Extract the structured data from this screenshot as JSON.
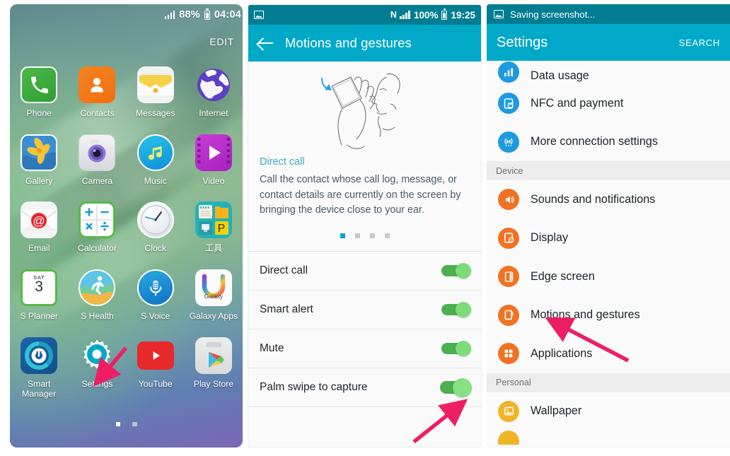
{
  "home": {
    "status": {
      "battery": "88%",
      "time": "04:04",
      "signal_icon": "signal-bars-icon",
      "battery_icon": "battery-icon"
    },
    "edit_label": "EDIT",
    "rows": [
      [
        {
          "label": "Phone",
          "icon": "phone-icon"
        },
        {
          "label": "Contacts",
          "icon": "contacts-icon"
        },
        {
          "label": "Messages",
          "icon": "messages-icon"
        },
        {
          "label": "Internet",
          "icon": "internet-icon"
        }
      ],
      [
        {
          "label": "Gallery",
          "icon": "gallery-icon"
        },
        {
          "label": "Camera",
          "icon": "camera-icon"
        },
        {
          "label": "Music",
          "icon": "music-icon"
        },
        {
          "label": "Video",
          "icon": "video-icon"
        }
      ],
      [
        {
          "label": "Email",
          "icon": "email-icon"
        },
        {
          "label": "Calculator",
          "icon": "calculator-icon"
        },
        {
          "label": "Clock",
          "icon": "clock-icon"
        },
        {
          "label": "工具",
          "icon": "tools-folder-icon"
        }
      ],
      [
        {
          "label": "S Planner",
          "icon": "s-planner-icon",
          "day": "SAT",
          "date": "3"
        },
        {
          "label": "S Health",
          "icon": "s-health-icon"
        },
        {
          "label": "S Voice",
          "icon": "s-voice-icon"
        },
        {
          "label": "Galaxy Apps",
          "icon": "galaxy-apps-icon",
          "badge": "Galaxy"
        }
      ],
      [
        {
          "label": "Smart\nManager",
          "icon": "smart-manager-icon"
        },
        {
          "label": "Settings",
          "icon": "settings-gear-icon"
        },
        {
          "label": "YouTube",
          "icon": "youtube-icon"
        },
        {
          "label": "Play Store",
          "icon": "play-store-icon"
        }
      ]
    ],
    "page_dots": {
      "count": 2,
      "active": 0
    }
  },
  "motions": {
    "status": {
      "nfc": "N",
      "battery": "100%",
      "time": "19:25",
      "screenshot_icon": "screenshot-icon",
      "signal_icon": "signal-bars-icon",
      "battery_icon": "battery-icon"
    },
    "appbar": {
      "title": "Motions and gestures",
      "back_icon": "back-arrow-icon"
    },
    "illustration": "direct-call-hand-phone-ear-illustration",
    "preview": {
      "title": "Direct call",
      "body": "Call the contact whose call log, message, or contact details are currently on the screen by bringing the device close to your ear.",
      "dots": {
        "count": 4,
        "active": 0
      }
    },
    "items": [
      {
        "label": "Direct call",
        "toggle": "on"
      },
      {
        "label": "Smart alert",
        "toggle": "on"
      },
      {
        "label": "Mute",
        "toggle": "on"
      },
      {
        "label": "Palm swipe to capture",
        "toggle": "on",
        "highlight": true
      }
    ]
  },
  "settings": {
    "notification": {
      "text": "Saving screenshot...",
      "icon": "screenshot-icon"
    },
    "appbar": {
      "title": "Settings",
      "search_label": "SEARCH"
    },
    "items": [
      {
        "type": "item",
        "label": "Data usage",
        "icon": "data-usage-icon",
        "color": "#1e9ae0",
        "clipped": "top"
      },
      {
        "type": "item",
        "label": "NFC and payment",
        "icon": "nfc-payment-icon",
        "color": "#1e9ae0"
      },
      {
        "type": "item",
        "label": "More connection settings",
        "icon": "more-connections-icon",
        "color": "#1e9ae0"
      },
      {
        "type": "head",
        "label": "Device"
      },
      {
        "type": "item",
        "label": "Sounds and notifications",
        "icon": "sound-icon",
        "color": "#ef7323"
      },
      {
        "type": "item",
        "label": "Display",
        "icon": "display-icon",
        "color": "#ef7323"
      },
      {
        "type": "item",
        "label": "Edge screen",
        "icon": "edge-screen-icon",
        "color": "#ef7323"
      },
      {
        "type": "item",
        "label": "Motions and gestures",
        "icon": "motions-gestures-icon",
        "color": "#ef7323"
      },
      {
        "type": "item",
        "label": "Applications",
        "icon": "applications-icon",
        "color": "#ef7323"
      },
      {
        "type": "head",
        "label": "Personal"
      },
      {
        "type": "item",
        "label": "Wallpaper",
        "icon": "wallpaper-icon",
        "color": "#f0b429"
      }
    ]
  },
  "annotations": {
    "arrow_color": "#ed1e64",
    "arrows": [
      {
        "name": "arrow-to-settings-icon",
        "target": "Settings app icon on home screen"
      },
      {
        "name": "arrow-to-palm-swipe-toggle",
        "target": "Palm swipe to capture toggle"
      },
      {
        "name": "arrow-to-motions-gestures",
        "target": "Motions and gestures settings row"
      }
    ]
  }
}
